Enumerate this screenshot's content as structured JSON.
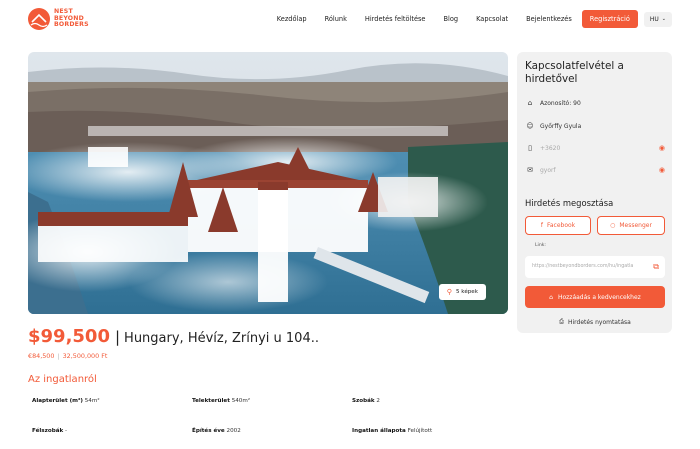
{
  "brand": {
    "line1": "NEST",
    "line2": "BEYOND",
    "line3": "BORDERS",
    "color": "#f25a38"
  },
  "nav": {
    "items": [
      "Kezdőlap",
      "Rólunk",
      "Hirdetés feltöltése",
      "Blog",
      "Kapcsolat",
      "Bejelentkezés"
    ],
    "register_label": "Regisztráció",
    "language": "HU"
  },
  "gallery": {
    "photos_button": "5 képek",
    "search_icon": "search-icon"
  },
  "listing": {
    "price_usd": "$99,500",
    "separator": "|",
    "address": "Hungary, Hévíz, Zrínyi u 104..",
    "price_eur": "€84,500",
    "price_huf": "32,500,000 Ft",
    "about_title": "Az ingatlanról",
    "attributes": [
      {
        "label": "Alapterület (m²)",
        "value": "54m²"
      },
      {
        "label": "Telekterület",
        "value": "540m²"
      },
      {
        "label": "Szobák",
        "value": "2"
      },
      {
        "label": "Félszobák",
        "value": "-"
      },
      {
        "label": "Építés éve",
        "value": "2002"
      },
      {
        "label": "Ingatlan állapota",
        "value": "Felújított"
      }
    ]
  },
  "contact": {
    "title": "Kapcsolatfelvétel a hirdetővel",
    "id_text": "Azonosító: 90",
    "name": "Győrffy Gyula",
    "phone": "+3620",
    "email": "gyorf"
  },
  "share": {
    "title": "Hirdetés megosztása",
    "facebook_label": "Facebook",
    "messenger_label": "Messenger",
    "link_label": "Link:",
    "link_value": "https://nestbeyondborders.com/hu/ingatla",
    "favorite_label": "Hozzáadás a kedvencekhez",
    "print_label": "Hirdetés nyomtatása"
  },
  "colors": {
    "accent": "#f25a38",
    "card_bg": "#f1f1f1"
  }
}
